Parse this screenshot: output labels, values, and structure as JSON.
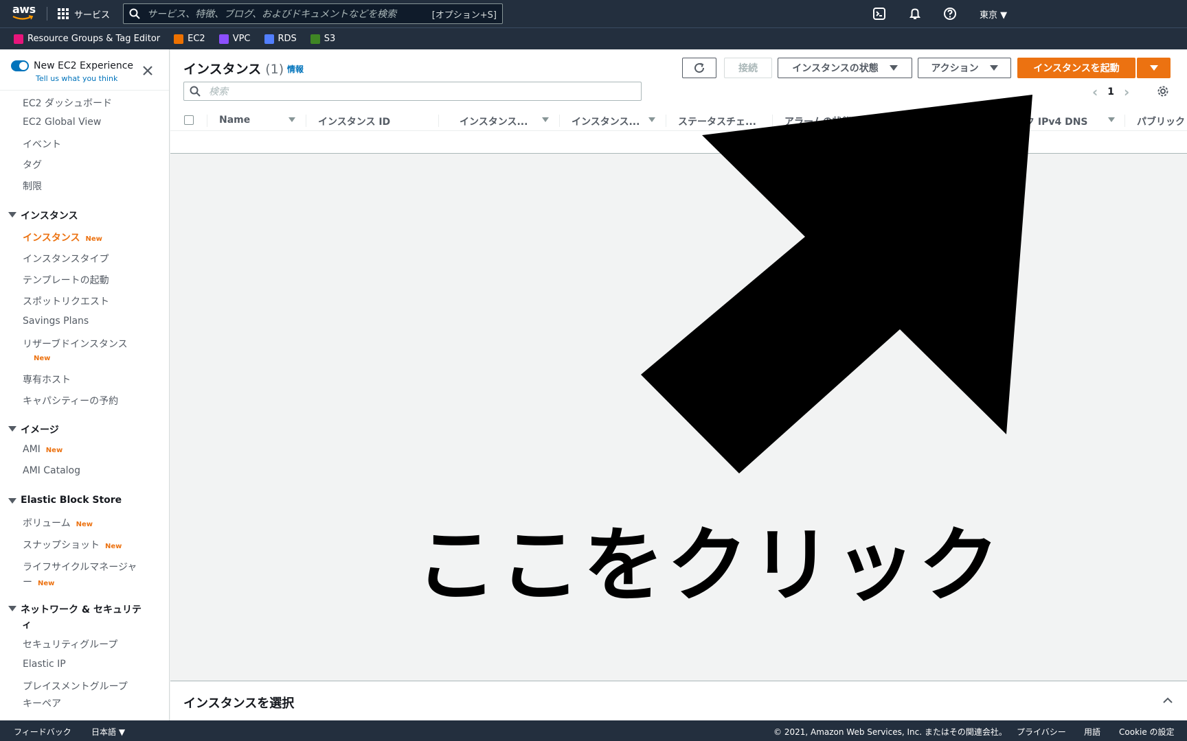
{
  "topnav": {
    "logo_text": "aws",
    "services_label": "サービス",
    "search_placeholder": "サービス、特徴、ブログ、およびドキュメントなどを検索",
    "search_shortcut": "[オプション+S]",
    "region_label": "東京 ▼"
  },
  "favorites": [
    {
      "label": "Resource Groups & Tag Editor",
      "color": "#e7157b"
    },
    {
      "label": "EC2",
      "color": "#ed7100"
    },
    {
      "label": "VPC",
      "color": "#8c4fff"
    },
    {
      "label": "RDS",
      "color": "#527fff"
    },
    {
      "label": "S3",
      "color": "#3f8624"
    }
  ],
  "sidebar": {
    "experience_title": "New EC2 Experience",
    "experience_sub": "Tell us what you think",
    "new_badge": "New",
    "items": {
      "dashboard": "EC2 ダッシュボード",
      "global_view": "EC2 Global View",
      "events": "イベント",
      "tags": "タグ",
      "limits": "制限",
      "instances_section": "インスタンス",
      "instances": "インスタンス",
      "instance_types": "インスタンスタイプ",
      "launch_templates": "テンプレートの起動",
      "spot_requests": "スポットリクエスト",
      "savings_plans": "Savings Plans",
      "reserved": "リザーブドインスタンス",
      "dedicated_hosts": "専有ホスト",
      "capacity_reservations": "キャパシティーの予約",
      "images_section": "イメージ",
      "ami": "AMI",
      "ami_catalog": "AMI Catalog",
      "ebs_section": "Elastic Block Store",
      "volumes": "ボリューム",
      "snapshots": "スナップショット",
      "lifecycle_1": "ライフサイクルマネージャ",
      "lifecycle_2": "ー",
      "network_section_1": "ネットワーク & セキュリテ",
      "network_section_2": "ィ",
      "security_groups": "セキュリティグループ",
      "elastic_ip": "Elastic IP",
      "placement_groups": "プレイスメントグループ",
      "key_pairs": "キーペア"
    }
  },
  "main": {
    "title": "インスタンス",
    "count": "(1)",
    "info_link": "情報",
    "buttons": {
      "connect": "接続",
      "instance_state": "インスタンスの状態",
      "actions": "アクション",
      "launch": "インスタンスを起動"
    },
    "search_placeholder": "検索",
    "page_number": "1",
    "columns": [
      "Name",
      "インスタンス ID",
      "インスタンス...",
      "インスタンス...",
      "ステータスチェ...",
      "アラームの状態",
      "ック IPv4 DNS",
      "パブリック"
    ]
  },
  "overlay": {
    "text": "ここをクリック"
  },
  "split_panel": {
    "label": "インスタンスを選択"
  },
  "footer": {
    "feedback": "フィードバック",
    "language": "日本語 ▼",
    "copyright": "© 2021, Amazon Web Services, Inc. またはその関連会社。",
    "privacy": "プライバシー",
    "terms": "用語",
    "cookie": "Cookie の設定"
  }
}
